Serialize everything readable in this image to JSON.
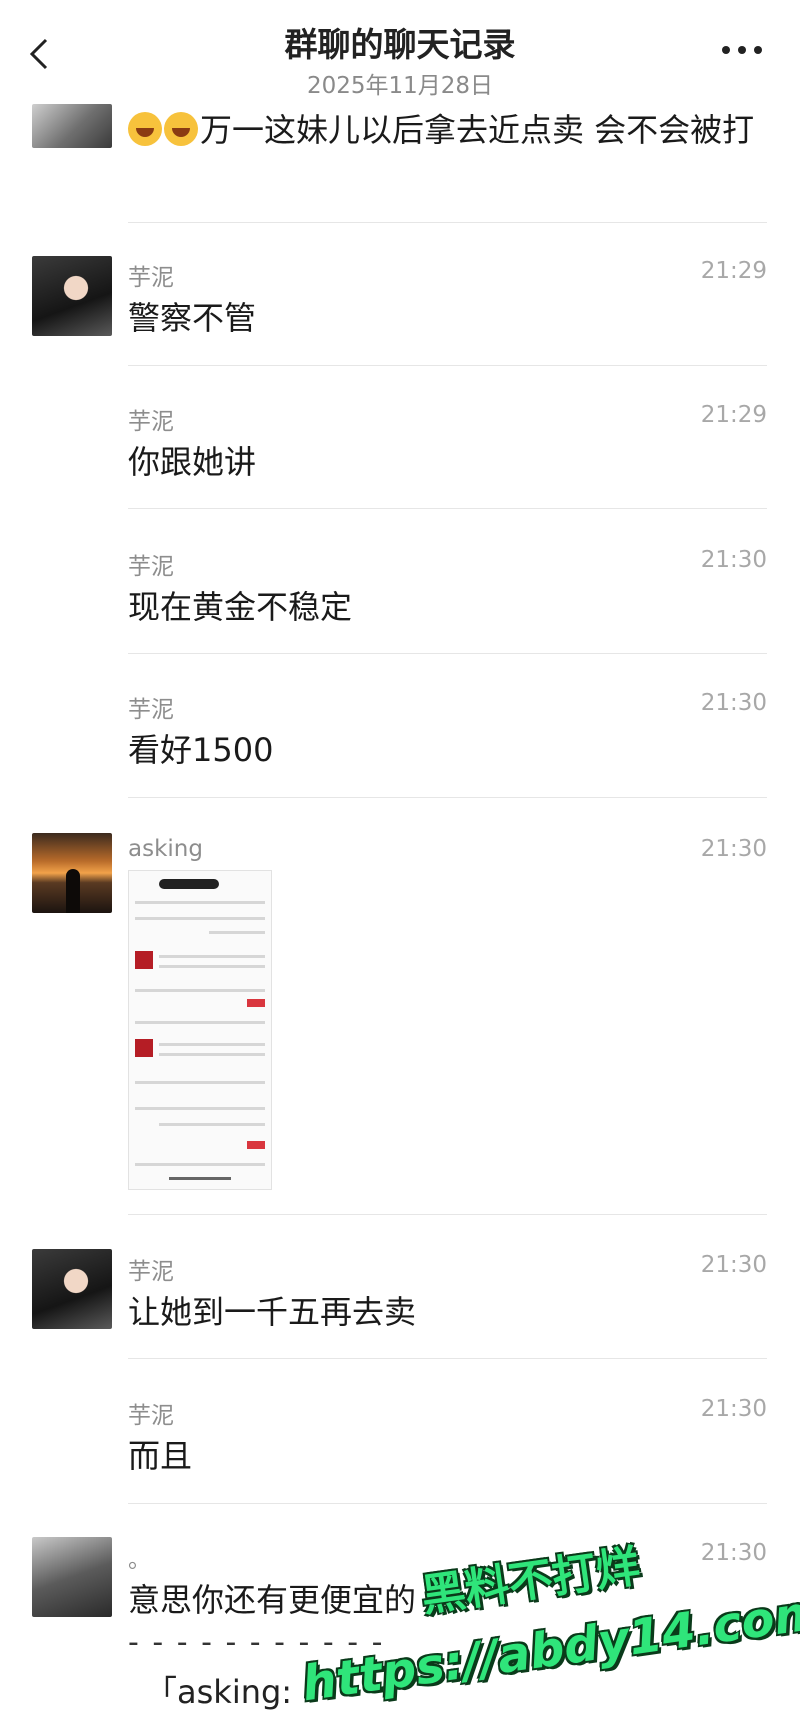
{
  "header": {
    "title": "群聊的聊天记录",
    "date": "2025年11月28日"
  },
  "messages": [
    {
      "sender": "",
      "time": "",
      "text": "万一这妹儿以后拿去近点卖  会不会被打",
      "emoji_count": 2
    },
    {
      "sender": "芋泥",
      "time": "21:29",
      "text": "警察不管"
    },
    {
      "sender": "芋泥",
      "time": "21:29",
      "text": "你跟她讲"
    },
    {
      "sender": "芋泥",
      "time": "21:30",
      "text": "现在黄金不稳定"
    },
    {
      "sender": "芋泥",
      "time": "21:30",
      "text": "看好1500"
    },
    {
      "sender": "asking",
      "time": "21:30",
      "text": "",
      "image": "screenshot-thumbnail"
    },
    {
      "sender": "芋泥",
      "time": "21:30",
      "text": "让她到一千五再去卖"
    },
    {
      "sender": "芋泥",
      "time": "21:30",
      "text": "而且"
    },
    {
      "sender": "。",
      "time": "21:30",
      "text": "意思你还有更便宜的"
    }
  ],
  "quote": {
    "separator": "- - - - - - - - - - -",
    "text": "「asking:"
  },
  "watermark": {
    "line1": "黑料不打烊",
    "line2": "https://abdy14.com"
  },
  "icons": {
    "back": "chevron-left-icon",
    "more": "more-dots-icon"
  }
}
